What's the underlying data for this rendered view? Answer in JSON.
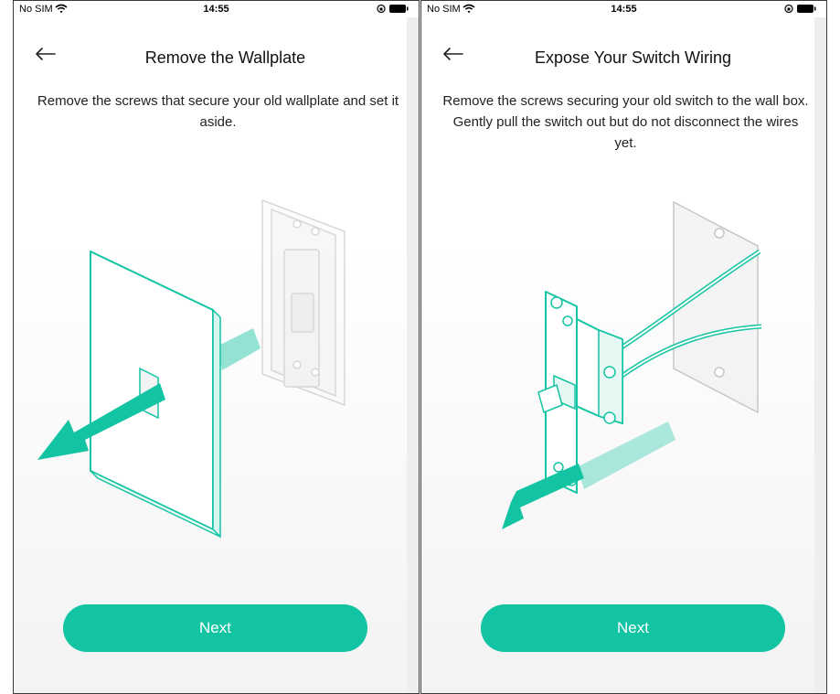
{
  "screens": [
    {
      "status": {
        "carrier": "No SIM",
        "time": "14:55"
      },
      "title": "Remove the Wallplate",
      "description": "Remove the screws that secure your old wallplate and set it aside.",
      "next_label": "Next"
    },
    {
      "status": {
        "carrier": "No SIM",
        "time": "14:55"
      },
      "title": "Expose Your Switch Wiring",
      "description": "Remove the screws securing your old switch to the wall box.  Gently pull the switch out but do not disconnect the wires yet.",
      "next_label": "Next"
    }
  ],
  "colors": {
    "accent": "#13c4a3",
    "text": "#111111"
  },
  "icons": [
    "wifi-icon",
    "battery-icon",
    "orientation-lock-icon",
    "back-arrow-icon",
    "arrow-icon"
  ]
}
